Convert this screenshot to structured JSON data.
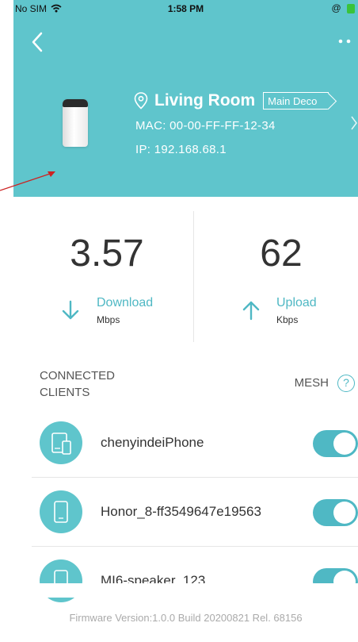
{
  "status_bar": {
    "carrier": "No SIM",
    "time": "1:58 PM"
  },
  "device": {
    "location": "Living Room",
    "role_tag": "Main Deco",
    "mac": "MAC: 00-00-FF-FF-12-34",
    "ip": "IP: 192.168.68.1"
  },
  "stats": {
    "download": {
      "value": "3.57",
      "label": "Download",
      "unit": "Mbps"
    },
    "upload": {
      "value": "62",
      "label": "Upload",
      "unit": "Kbps"
    }
  },
  "clients_section": {
    "title": "CONNECTED CLIENTS",
    "mesh_label": "MESH",
    "help": "?"
  },
  "clients": [
    {
      "name": "chenyindeiPhone",
      "icon": "phone-tablet-icon",
      "enabled": true
    },
    {
      "name": "Honor_8-ff3549647e19563",
      "icon": "phone-icon",
      "enabled": true
    },
    {
      "name": "MI6-speaker_123",
      "icon": "phone-icon",
      "enabled": true
    }
  ],
  "footer": {
    "firmware": "Firmware Version:1.0.0 Build 20200821 Rel. 68156"
  },
  "colors": {
    "header": "#5fc5cc",
    "accent": "#4fb8c4",
    "annotation": "#cc2222"
  }
}
